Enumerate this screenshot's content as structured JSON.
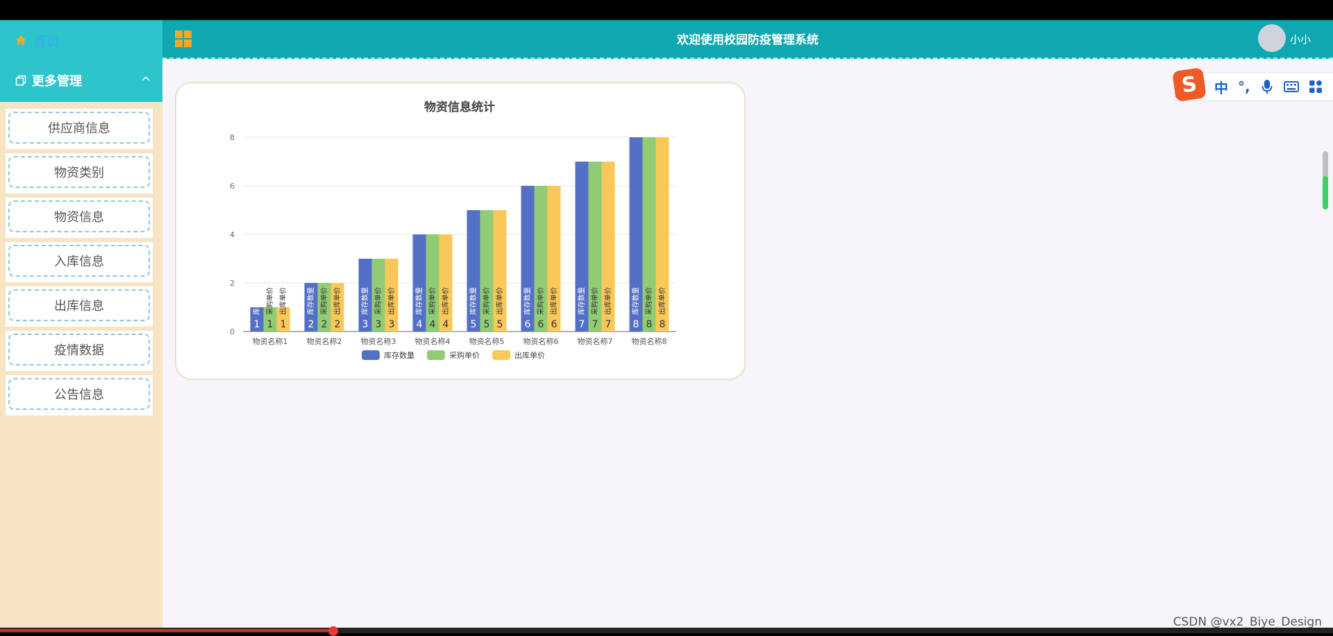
{
  "sidebar": {
    "home_label": "首页",
    "section_label": "更多管理",
    "items": [
      {
        "label": "供应商信息"
      },
      {
        "label": "物资类别"
      },
      {
        "label": "物资信息"
      },
      {
        "label": "入库信息"
      },
      {
        "label": "出库信息"
      },
      {
        "label": "疫情数据"
      },
      {
        "label": "公告信息"
      }
    ]
  },
  "header": {
    "title": "欢迎使用校园防疫管理系统",
    "username": "小小"
  },
  "ime": {
    "logo": "S",
    "items": [
      "中",
      "°,"
    ]
  },
  "watermark": "CSDN @vx2_Biye_Design",
  "colors": {
    "sidebar_top": "#2ec4cc",
    "header": "#0fa7b0",
    "sidebar_bg": "#f6e4c4",
    "series": [
      "#5470c6",
      "#91cc75",
      "#fac858"
    ]
  },
  "video_progress": 0.25,
  "chart_data": {
    "type": "bar",
    "title": "物资信息统计",
    "categories": [
      "物资名称1",
      "物资名称2",
      "物资名称3",
      "物资名称4",
      "物资名称5",
      "物资名称6",
      "物资名称7",
      "物资名称8"
    ],
    "series": [
      {
        "name": "库存数量",
        "values": [
          1,
          2,
          3,
          4,
          5,
          6,
          7,
          8
        ]
      },
      {
        "name": "采购单价",
        "values": [
          1,
          2,
          3,
          4,
          5,
          6,
          7,
          8
        ]
      },
      {
        "name": "出库单价",
        "values": [
          1,
          2,
          3,
          4,
          5,
          6,
          7,
          8
        ]
      }
    ],
    "ylim": [
      0,
      8
    ],
    "yticks": [
      0,
      2,
      4,
      6,
      8
    ],
    "grid": true,
    "legend": "bottom-center"
  }
}
